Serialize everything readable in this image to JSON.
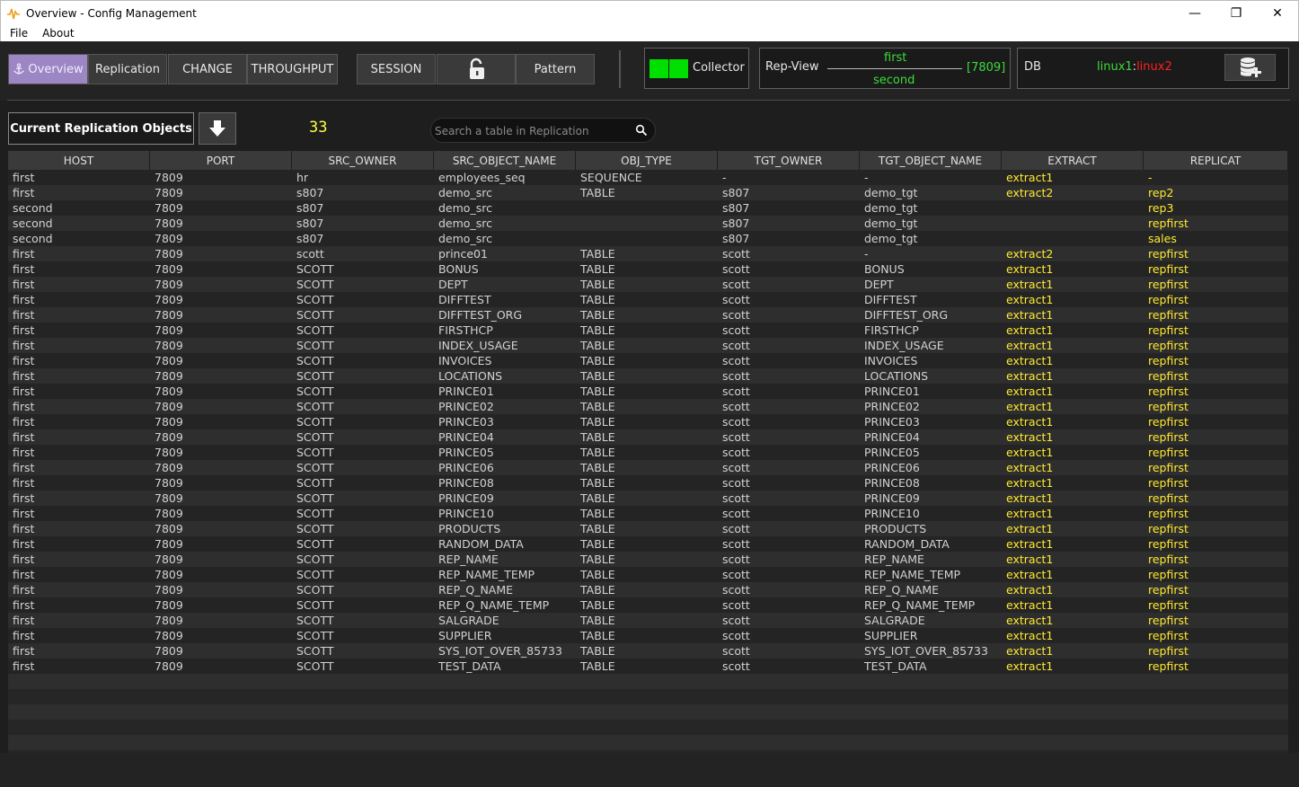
{
  "window": {
    "title": "Overview - Config Management",
    "controls": {
      "minimize": "—",
      "maximize": "❐",
      "close": "✕"
    }
  },
  "menu": {
    "file": "File",
    "about": "About"
  },
  "toolbar": {
    "overview": "Overview",
    "replication": "Replication",
    "change": "CHANGE",
    "throughput": "THROUGHPUT",
    "session": "SESSION",
    "pattern": "Pattern"
  },
  "collector": {
    "label": "Collector",
    "status_color": "#00e000"
  },
  "repview": {
    "label": "Rep-View",
    "first": "first",
    "second": "second",
    "port": "[7809]"
  },
  "db": {
    "label": "DB",
    "node1": "linux1",
    "sep": ":",
    "node2": "linux2"
  },
  "section": {
    "title": "Current Replication Objects",
    "count": "33",
    "search_placeholder": "Search a table in Replication"
  },
  "table": {
    "columns": [
      "HOST",
      "PORT",
      "SRC_OWNER",
      "SRC_OBJECT_NAME",
      "OBJ_TYPE",
      "TGT_OWNER",
      "TGT_OBJECT_NAME",
      "EXTRACT",
      "REPLICAT"
    ],
    "rows": [
      [
        "first",
        "7809",
        "hr",
        "employees_seq",
        "SEQUENCE",
        "-",
        "-",
        "extract1",
        "-"
      ],
      [
        "first",
        "7809",
        "s807",
        "demo_src",
        "TABLE",
        "s807",
        "demo_tgt",
        "extract2",
        "rep2"
      ],
      [
        "second",
        "7809",
        "s807",
        "demo_src",
        "",
        "s807",
        "demo_tgt",
        "",
        "rep3"
      ],
      [
        "second",
        "7809",
        "s807",
        "demo_src",
        "",
        "s807",
        "demo_tgt",
        "",
        "repfirst"
      ],
      [
        "second",
        "7809",
        "s807",
        "demo_src",
        "",
        "s807",
        "demo_tgt",
        "",
        "sales"
      ],
      [
        "first",
        "7809",
        "scott",
        "prince01",
        "TABLE",
        "scott",
        "-",
        "extract2",
        "repfirst"
      ],
      [
        "first",
        "7809",
        "SCOTT",
        "BONUS",
        "TABLE",
        "scott",
        "BONUS",
        "extract1",
        "repfirst"
      ],
      [
        "first",
        "7809",
        "SCOTT",
        "DEPT",
        "TABLE",
        "scott",
        "DEPT",
        "extract1",
        "repfirst"
      ],
      [
        "first",
        "7809",
        "SCOTT",
        "DIFFTEST",
        "TABLE",
        "scott",
        "DIFFTEST",
        "extract1",
        "repfirst"
      ],
      [
        "first",
        "7809",
        "SCOTT",
        "DIFFTEST_ORG",
        "TABLE",
        "scott",
        "DIFFTEST_ORG",
        "extract1",
        "repfirst"
      ],
      [
        "first",
        "7809",
        "SCOTT",
        "FIRSTHCP",
        "TABLE",
        "scott",
        "FIRSTHCP",
        "extract1",
        "repfirst"
      ],
      [
        "first",
        "7809",
        "SCOTT",
        "INDEX_USAGE",
        "TABLE",
        "scott",
        "INDEX_USAGE",
        "extract1",
        "repfirst"
      ],
      [
        "first",
        "7809",
        "SCOTT",
        "INVOICES",
        "TABLE",
        "scott",
        "INVOICES",
        "extract1",
        "repfirst"
      ],
      [
        "first",
        "7809",
        "SCOTT",
        "LOCATIONS",
        "TABLE",
        "scott",
        "LOCATIONS",
        "extract1",
        "repfirst"
      ],
      [
        "first",
        "7809",
        "SCOTT",
        "PRINCE01",
        "TABLE",
        "scott",
        "PRINCE01",
        "extract1",
        "repfirst"
      ],
      [
        "first",
        "7809",
        "SCOTT",
        "PRINCE02",
        "TABLE",
        "scott",
        "PRINCE02",
        "extract1",
        "repfirst"
      ],
      [
        "first",
        "7809",
        "SCOTT",
        "PRINCE03",
        "TABLE",
        "scott",
        "PRINCE03",
        "extract1",
        "repfirst"
      ],
      [
        "first",
        "7809",
        "SCOTT",
        "PRINCE04",
        "TABLE",
        "scott",
        "PRINCE04",
        "extract1",
        "repfirst"
      ],
      [
        "first",
        "7809",
        "SCOTT",
        "PRINCE05",
        "TABLE",
        "scott",
        "PRINCE05",
        "extract1",
        "repfirst"
      ],
      [
        "first",
        "7809",
        "SCOTT",
        "PRINCE06",
        "TABLE",
        "scott",
        "PRINCE06",
        "extract1",
        "repfirst"
      ],
      [
        "first",
        "7809",
        "SCOTT",
        "PRINCE08",
        "TABLE",
        "scott",
        "PRINCE08",
        "extract1",
        "repfirst"
      ],
      [
        "first",
        "7809",
        "SCOTT",
        "PRINCE09",
        "TABLE",
        "scott",
        "PRINCE09",
        "extract1",
        "repfirst"
      ],
      [
        "first",
        "7809",
        "SCOTT",
        "PRINCE10",
        "TABLE",
        "scott",
        "PRINCE10",
        "extract1",
        "repfirst"
      ],
      [
        "first",
        "7809",
        "SCOTT",
        "PRODUCTS",
        "TABLE",
        "scott",
        "PRODUCTS",
        "extract1",
        "repfirst"
      ],
      [
        "first",
        "7809",
        "SCOTT",
        "RANDOM_DATA",
        "TABLE",
        "scott",
        "RANDOM_DATA",
        "extract1",
        "repfirst"
      ],
      [
        "first",
        "7809",
        "SCOTT",
        "REP_NAME",
        "TABLE",
        "scott",
        "REP_NAME",
        "extract1",
        "repfirst"
      ],
      [
        "first",
        "7809",
        "SCOTT",
        "REP_NAME_TEMP",
        "TABLE",
        "scott",
        "REP_NAME_TEMP",
        "extract1",
        "repfirst"
      ],
      [
        "first",
        "7809",
        "SCOTT",
        "REP_Q_NAME",
        "TABLE",
        "scott",
        "REP_Q_NAME",
        "extract1",
        "repfirst"
      ],
      [
        "first",
        "7809",
        "SCOTT",
        "REP_Q_NAME_TEMP",
        "TABLE",
        "scott",
        "REP_Q_NAME_TEMP",
        "extract1",
        "repfirst"
      ],
      [
        "first",
        "7809",
        "SCOTT",
        "SALGRADE",
        "TABLE",
        "scott",
        "SALGRADE",
        "extract1",
        "repfirst"
      ],
      [
        "first",
        "7809",
        "SCOTT",
        "SUPPLIER",
        "TABLE",
        "scott",
        "SUPPLIER",
        "extract1",
        "repfirst"
      ],
      [
        "first",
        "7809",
        "SCOTT",
        "SYS_IOT_OVER_85733",
        "TABLE",
        "scott",
        "SYS_IOT_OVER_85733",
        "extract1",
        "repfirst"
      ],
      [
        "first",
        "7809",
        "SCOTT",
        "TEST_DATA",
        "TABLE",
        "scott",
        "TEST_DATA",
        "extract1",
        "repfirst"
      ]
    ]
  },
  "colors": {
    "active_tab": "#9c86c4",
    "status_green": "#3cdc3c",
    "status_red": "#ff2020",
    "count_yellow": "#ffff40",
    "extract_yellow": "#ffea30"
  }
}
